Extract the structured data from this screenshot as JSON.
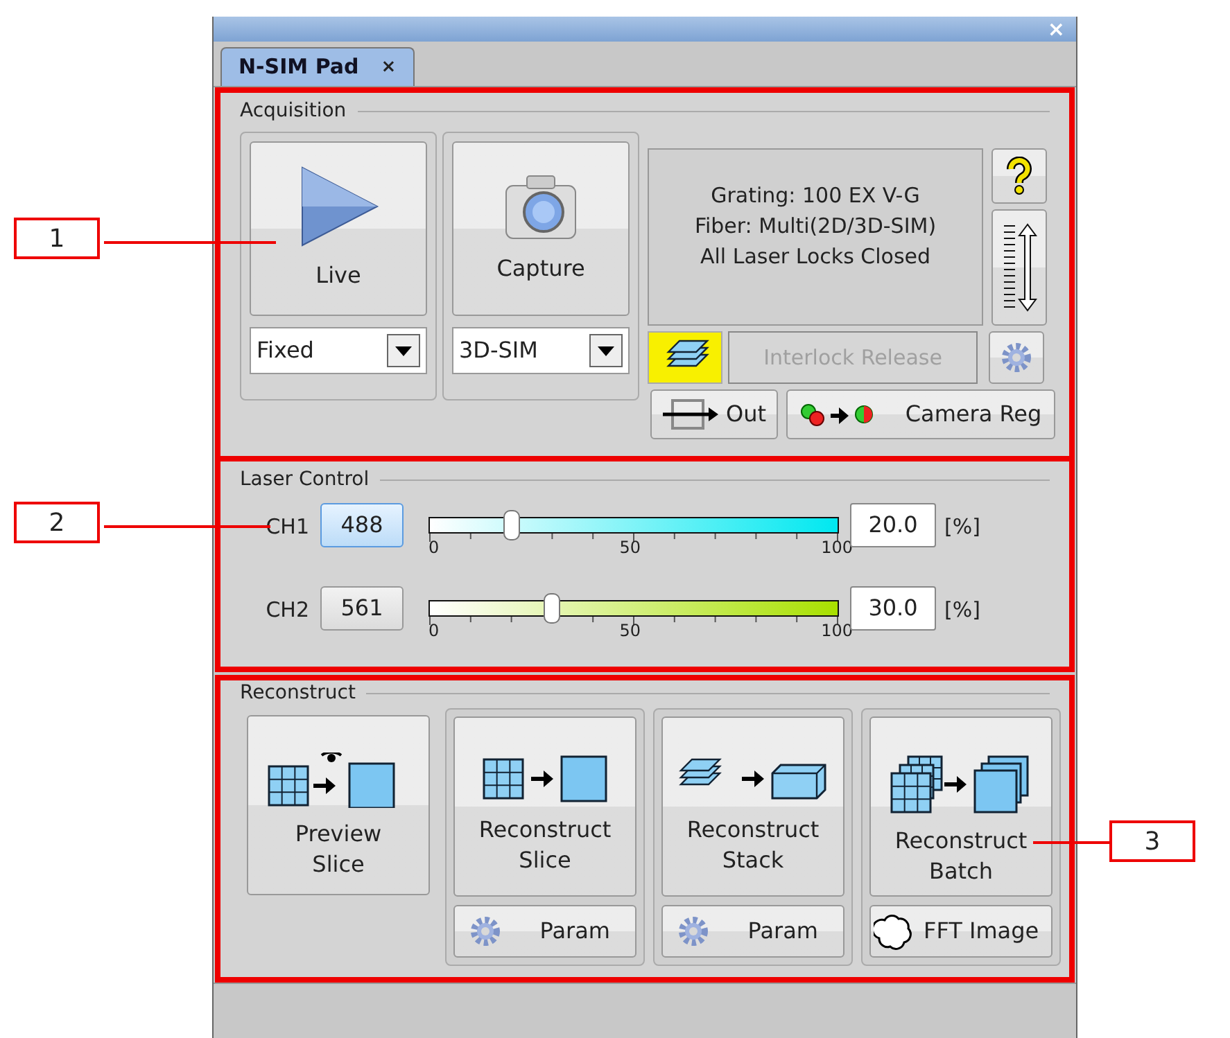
{
  "window": {
    "close": "×"
  },
  "tab": {
    "label": "N-SIM Pad",
    "close": "×",
    "selected": true
  },
  "acquisition": {
    "title": "Acquisition",
    "live": {
      "label": "Live",
      "mode": "Fixed"
    },
    "capture": {
      "label": "Capture",
      "mode": "3D-SIM"
    },
    "status_lines": [
      "Grating: 100 EX V-G",
      "Fiber: Multi(2D/3D-SIM)",
      "All Laser Locks Closed"
    ],
    "layer_toggle": {
      "on": true
    },
    "interlock": {
      "label": "Interlock Release",
      "disabled": true
    },
    "out": {
      "label": "Out"
    },
    "camera_reg": {
      "label": "Camera Reg"
    }
  },
  "laser_control": {
    "title": "Laser Control",
    "channels": [
      {
        "name": "CH1",
        "wavelength": "488",
        "selected": true,
        "level": 0.2,
        "color": "#00e8f0",
        "ticks": [
          "0",
          "50",
          "100"
        ],
        "value": "20.0",
        "unit": "[%]"
      },
      {
        "name": "CH2",
        "wavelength": "561",
        "selected": false,
        "level": 0.3,
        "color": "#a8e000",
        "ticks": [
          "0",
          "50",
          "100"
        ],
        "value": "30.0",
        "unit": "[%]"
      }
    ]
  },
  "reconstruct": {
    "title": "Reconstruct",
    "buttons": [
      {
        "kind": "preview",
        "label": "Preview Slice"
      },
      {
        "kind": "slice",
        "label": "Reconstruct Slice",
        "sub": {
          "kind": "gear",
          "label": "Param"
        }
      },
      {
        "kind": "stack",
        "label": "Reconstruct Stack",
        "sub": {
          "kind": "gear",
          "label": "Param"
        }
      },
      {
        "kind": "batch",
        "label": "Reconstruct Batch",
        "sub": {
          "kind": "cloud",
          "label": "FFT Image"
        }
      }
    ]
  },
  "callouts": [
    {
      "label": "1"
    },
    {
      "label": "2"
    },
    {
      "label": "3"
    }
  ]
}
